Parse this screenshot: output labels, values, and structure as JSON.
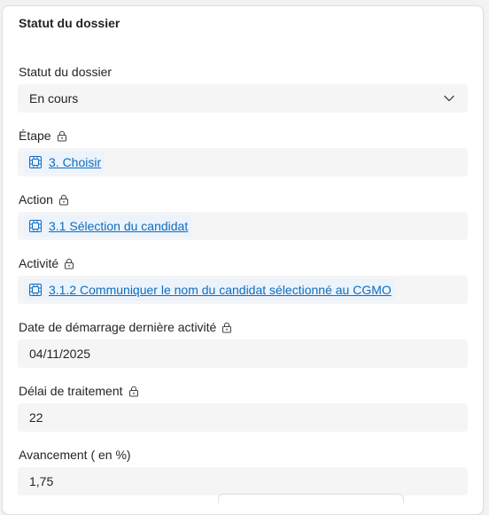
{
  "section": {
    "title": "Statut du dossier"
  },
  "fields": [
    {
      "label": "Statut du dossier",
      "value": "En cours",
      "locked": false
    },
    {
      "label": "Étape",
      "value": "3. Choisir",
      "locked": true
    },
    {
      "label": "Action",
      "value": "3.1 Sélection du candidat",
      "locked": true
    },
    {
      "label": "Activité",
      "value": "3.1.2 Communiquer le nom du candidat sélectionné au CGMO",
      "locked": true
    },
    {
      "label": "Date de démarrage dernière activité",
      "value": "04/11/2025",
      "locked": true
    },
    {
      "label": "Délai de traitement",
      "value": "22",
      "locked": true
    },
    {
      "label": "Avancement ( en %)",
      "value": "1,75",
      "locked": false
    }
  ],
  "colors": {
    "link": "#0f6cbd",
    "field_bg": "#f5f5f5",
    "lookup_bg": "#ebf3fc"
  },
  "icons": {
    "lock": "lock-icon",
    "entity": "entity-record-icon",
    "chevron": "chevron-down-icon"
  }
}
